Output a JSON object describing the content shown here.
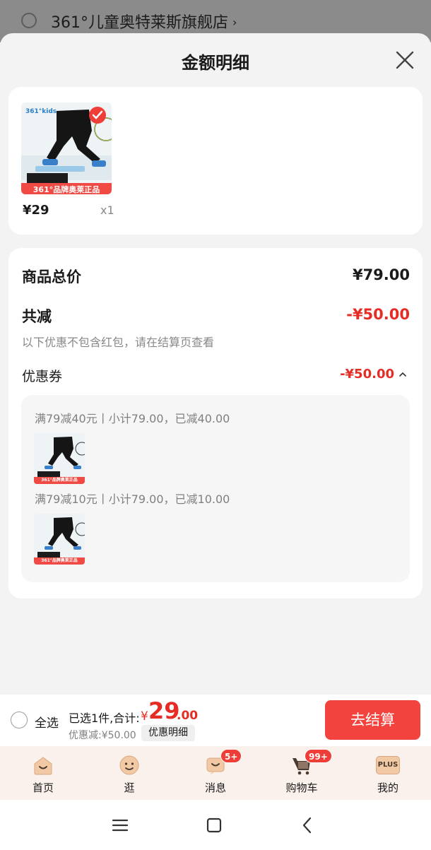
{
  "background": {
    "store_name": "361°儿童奥特莱斯旗舰店",
    "chevron": "›"
  },
  "sheet": {
    "title": "金额明细",
    "close_icon": "close-icon"
  },
  "product": {
    "brand_text": "361°kids",
    "banner_text": "361°品牌奥莱正品",
    "price": "¥29",
    "quantity": "x1"
  },
  "summary": {
    "total_label": "商品总价",
    "total_value": "¥79.00",
    "reduce_label": "共减",
    "reduce_value": "-¥50.00",
    "note": "以下优惠不包含红包，请在结算页查看",
    "coupon_label": "优惠券",
    "coupon_value": "-¥50.00",
    "coupon_toggle_icon": "chevron-up-icon"
  },
  "coupons": [
    {
      "text": "满79减40元丨小计79.00，已减40.00",
      "banner_text": "361°品牌奥莱正品"
    },
    {
      "text": "满79减10元丨小计79.00，已减10.00",
      "banner_text": "361°品牌奥莱正品"
    }
  ],
  "checkout": {
    "select_all": "全选",
    "selected_text": "已选1件,合计:",
    "currency": "¥",
    "amount_int": "29",
    "amount_dec": ".00",
    "discount_text": "优惠减:¥50.00",
    "detail_button": "优惠明细",
    "checkout_button": "去结算"
  },
  "tabbar": {
    "tabs": [
      {
        "label": "首页",
        "icon": "home-icon"
      },
      {
        "label": "逛",
        "icon": "face-icon"
      },
      {
        "label": "消息",
        "icon": "message-icon",
        "badge": "5+"
      },
      {
        "label": "购物车",
        "icon": "cart-icon",
        "badge": "99+"
      },
      {
        "label": "我的",
        "icon": "plus-icon",
        "icon_text": "PLUS"
      }
    ]
  },
  "system_nav": {
    "menu_icon": "menu-icon",
    "home_icon": "square-icon",
    "back_icon": "back-icon"
  },
  "colors": {
    "accent_red": "#e52d25",
    "button_red": "#f2433e",
    "tabbar_bg": "#fbf1ec"
  }
}
